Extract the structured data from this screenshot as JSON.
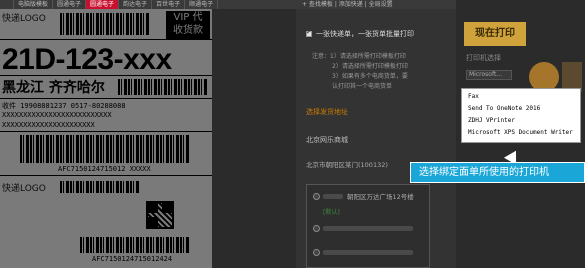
{
  "tabbar": {
    "tabs": [
      "",
      "电脑版模板",
      "圆通电子",
      "圆通电子",
      "韵达电子",
      "百世电子",
      "顺通电子"
    ],
    "active_index": 3
  },
  "panel_top": {
    "text": "+ 查找模板 | 添加快递 | 全局设置"
  },
  "waybill": {
    "logo": "快递LOGO",
    "vip_line1": "VIP 代",
    "vip_line2": "收货款",
    "big_code": "21D-123-xxx",
    "city": "黑龙江  齐齐哈尔",
    "phone": "收件  19908881237  0517-80288088",
    "address1": "XXXXXXXXXXXXXXXXXXXXXXXXXX",
    "address2": "XXXXXXXXXXXXXXXXXXXXXX",
    "barcode_num": "AFC7150124715012 XXXXX",
    "barcode_num_bottom": "AFC7150124715012424"
  },
  "panel": {
    "check_label": "一张快递单，一张货单批量打印",
    "notes": [
      "注意：1）请选择所需打印模板打印",
      "2）请选择所需打印模板打印",
      "3）如果有多个电商货单，要",
      "认打印其一个电商货单"
    ],
    "select_title": "选择发货地址",
    "sub_title": "北京网乐商城",
    "address": "北京市朝阳区某门(100132)",
    "addr_line": "朝阳区万达广场12号楼",
    "green_tag": "[默认]"
  },
  "right": {
    "print_button": "现在打印",
    "side_label": "打印机选择",
    "side_select": "Microsoft..."
  },
  "dropdown": {
    "items": [
      "Fax",
      "Send To OneNote 2016",
      "ZDHJ VPrinter",
      "Microsoft XPS Document Writer"
    ]
  },
  "callout": {
    "text": "选择绑定面单所使用的打印机"
  },
  "colors": {
    "accent_red": "#c8102e",
    "print_gold": "#cfa23c",
    "callout_blue": "#1aa7d8"
  }
}
